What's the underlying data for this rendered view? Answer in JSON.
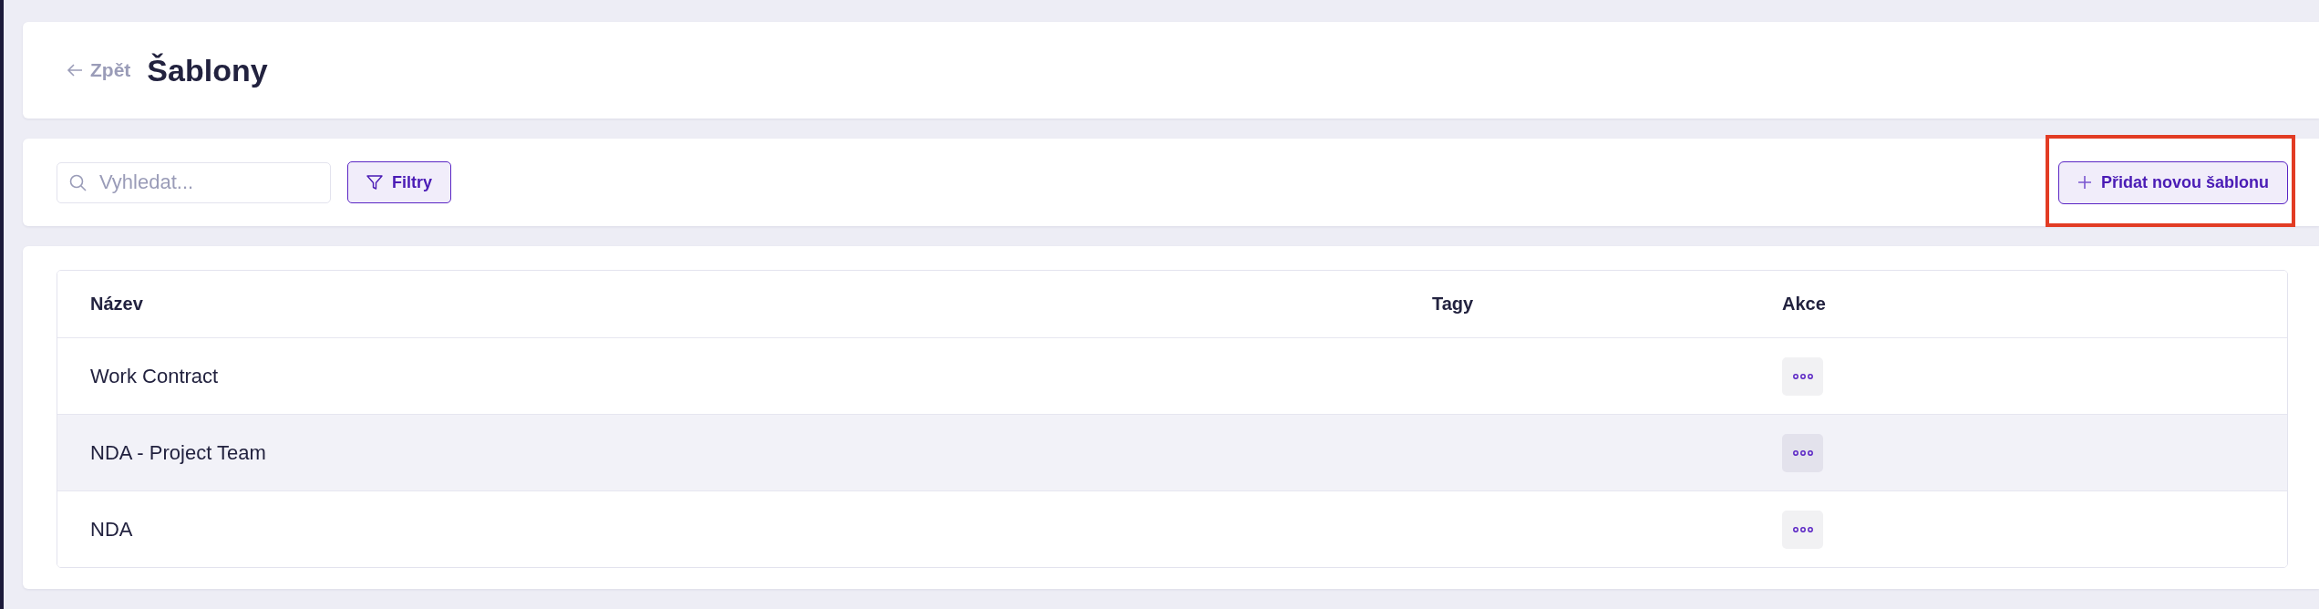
{
  "header": {
    "back_link": "Zpět",
    "title": "Šablony"
  },
  "toolbar": {
    "search": {
      "placeholder": "Vyhledat..."
    },
    "filter_button": "Filtry",
    "add_button": {
      "label": "Přidat novou šablonu",
      "highlighted": true
    }
  },
  "table": {
    "columns": [
      "Název",
      "Tagy",
      "Akce"
    ],
    "rows": [
      {
        "name": "Work Contract",
        "hovered": false
      },
      {
        "name": "NDA - Project Team",
        "hovered": true
      },
      {
        "name": "NDA",
        "hovered": false
      }
    ]
  }
}
